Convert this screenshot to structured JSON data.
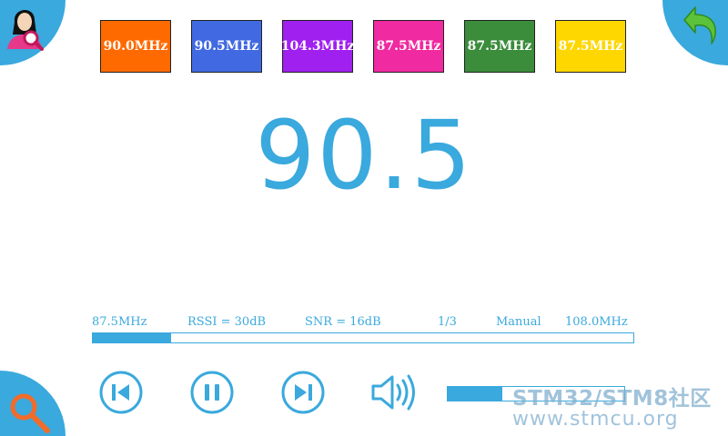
{
  "presets": [
    {
      "label": "90.0MHz",
      "color": "#ff6a00"
    },
    {
      "label": "90.5MHz",
      "color": "#4169e1"
    },
    {
      "label": "104.3MHz",
      "color": "#a020f0"
    },
    {
      "label": "87.5MHz",
      "color": "#f02aa0"
    },
    {
      "label": "87.5MHz",
      "color": "#3b8c3b"
    },
    {
      "label": "87.5MHz",
      "color": "#ffd700"
    }
  ],
  "frequency": "90.5",
  "info": {
    "min_freq": "87.5MHz",
    "rssi": "RSSI = 30dB",
    "snr": "SNR = 16dB",
    "page": "1/3",
    "mode": "Manual",
    "max_freq": "108.0MHz"
  },
  "tuning_progress_fraction": 0.145,
  "volume_fraction": 0.31,
  "icons": {
    "top_left": "user-search-icon",
    "top_right": "back-arrow-icon",
    "bottom_left": "search-icon",
    "prev": "skip-previous-icon",
    "pause": "pause-icon",
    "next": "skip-next-icon",
    "speaker": "speaker-icon"
  },
  "watermark": {
    "line1": "STM32/STM8社区",
    "line2": "www.stmcu.org"
  },
  "accent_color": "#3aa9dd"
}
